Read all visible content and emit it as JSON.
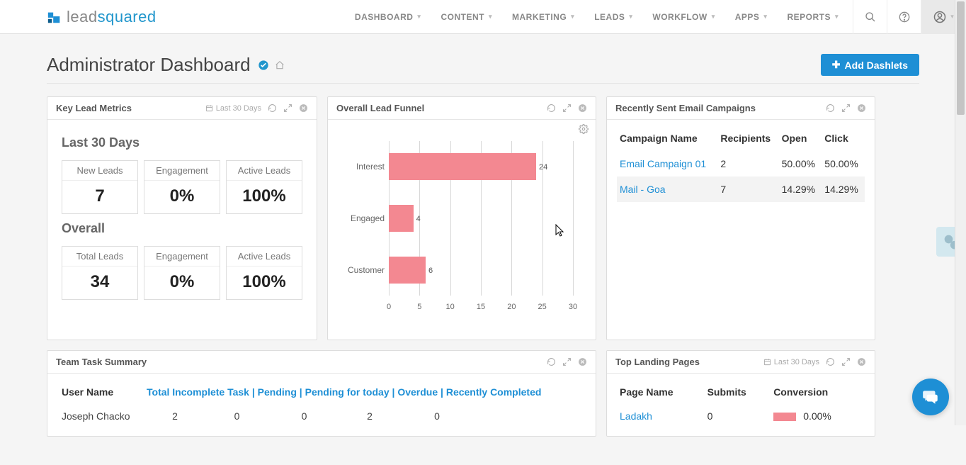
{
  "brand": {
    "lead": "lead",
    "squared": "squared"
  },
  "nav": {
    "items": [
      "DASHBOARD",
      "CONTENT",
      "MARKETING",
      "LEADS",
      "WORKFLOW",
      "APPS",
      "REPORTS"
    ]
  },
  "header": {
    "title": "Administrator Dashboard",
    "add_button": "Add Dashlets"
  },
  "key_metrics": {
    "title": "Key Lead Metrics",
    "period": "Last 30 Days",
    "last30_label": "Last 30 Days",
    "cards_last30": [
      {
        "label": "New Leads",
        "value": "7"
      },
      {
        "label": "Engagement",
        "value": "0%"
      },
      {
        "label": "Active Leads",
        "value": "100%"
      }
    ],
    "overall_label": "Overall",
    "cards_overall": [
      {
        "label": "Total Leads",
        "value": "34"
      },
      {
        "label": "Engagement",
        "value": "0%"
      },
      {
        "label": "Active Leads",
        "value": "100%"
      }
    ]
  },
  "funnel": {
    "title": "Overall Lead Funnel"
  },
  "campaigns": {
    "title": "Recently Sent Email Campaigns",
    "cols": {
      "name": "Campaign Name",
      "recipients": "Recipients",
      "open": "Open",
      "click": "Click"
    },
    "rows": [
      {
        "name": "Email Campaign 01",
        "recipients": "2",
        "open": "50.00%",
        "click": "50.00%"
      },
      {
        "name": "Mail - Goa",
        "recipients": "7",
        "open": "14.29%",
        "click": "14.29%"
      }
    ]
  },
  "team": {
    "title": "Team Task Summary",
    "cols": {
      "user": "User Name",
      "incomplete": "Total Incomplete Task",
      "pending": "Pending",
      "pending_today": "Pending for today",
      "overdue": "Overdue",
      "recent": "Recently Completed"
    },
    "sep": " | ",
    "rows": [
      {
        "user": "Joseph Chacko",
        "incomplete": "2",
        "pending": "0",
        "pending_today": "0",
        "overdue": "2",
        "recent": "0"
      }
    ]
  },
  "landing": {
    "title": "Top Landing Pages",
    "period": "Last 30 Days",
    "cols": {
      "name": "Page Name",
      "submits": "Submits",
      "conversion": "Conversion"
    },
    "rows": [
      {
        "name": "Ladakh",
        "submits": "0",
        "conversion": "0.00%"
      }
    ]
  },
  "chart_data": {
    "type": "bar",
    "orientation": "horizontal",
    "categories": [
      "Interest",
      "Engaged",
      "Customer"
    ],
    "values": [
      24,
      4,
      6
    ],
    "title": "Overall Lead Funnel",
    "xlabel": "",
    "ylabel": "",
    "xlim": [
      0,
      30
    ],
    "xticks": [
      0,
      5,
      10,
      15,
      20,
      25,
      30
    ],
    "color": "#f38891"
  }
}
